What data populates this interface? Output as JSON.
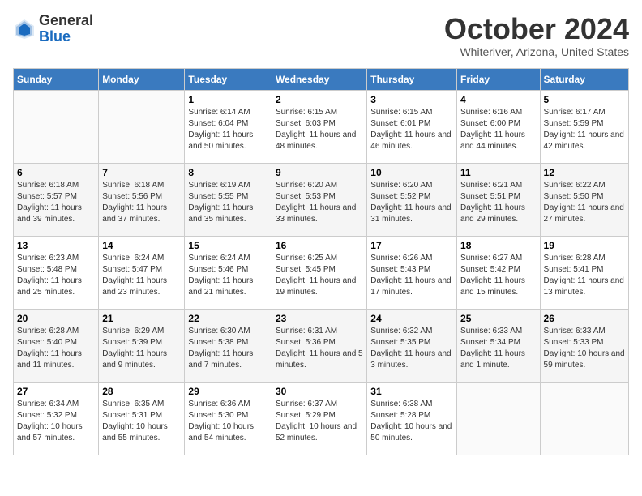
{
  "header": {
    "logo_line1": "General",
    "logo_line2": "Blue",
    "month_title": "October 2024",
    "location": "Whiteriver, Arizona, United States"
  },
  "days_of_week": [
    "Sunday",
    "Monday",
    "Tuesday",
    "Wednesday",
    "Thursday",
    "Friday",
    "Saturday"
  ],
  "weeks": [
    [
      {
        "day": "",
        "info": ""
      },
      {
        "day": "",
        "info": ""
      },
      {
        "day": "1",
        "info": "Sunrise: 6:14 AM\nSunset: 6:04 PM\nDaylight: 11 hours and 50 minutes."
      },
      {
        "day": "2",
        "info": "Sunrise: 6:15 AM\nSunset: 6:03 PM\nDaylight: 11 hours and 48 minutes."
      },
      {
        "day": "3",
        "info": "Sunrise: 6:15 AM\nSunset: 6:01 PM\nDaylight: 11 hours and 46 minutes."
      },
      {
        "day": "4",
        "info": "Sunrise: 6:16 AM\nSunset: 6:00 PM\nDaylight: 11 hours and 44 minutes."
      },
      {
        "day": "5",
        "info": "Sunrise: 6:17 AM\nSunset: 5:59 PM\nDaylight: 11 hours and 42 minutes."
      }
    ],
    [
      {
        "day": "6",
        "info": "Sunrise: 6:18 AM\nSunset: 5:57 PM\nDaylight: 11 hours and 39 minutes."
      },
      {
        "day": "7",
        "info": "Sunrise: 6:18 AM\nSunset: 5:56 PM\nDaylight: 11 hours and 37 minutes."
      },
      {
        "day": "8",
        "info": "Sunrise: 6:19 AM\nSunset: 5:55 PM\nDaylight: 11 hours and 35 minutes."
      },
      {
        "day": "9",
        "info": "Sunrise: 6:20 AM\nSunset: 5:53 PM\nDaylight: 11 hours and 33 minutes."
      },
      {
        "day": "10",
        "info": "Sunrise: 6:20 AM\nSunset: 5:52 PM\nDaylight: 11 hours and 31 minutes."
      },
      {
        "day": "11",
        "info": "Sunrise: 6:21 AM\nSunset: 5:51 PM\nDaylight: 11 hours and 29 minutes."
      },
      {
        "day": "12",
        "info": "Sunrise: 6:22 AM\nSunset: 5:50 PM\nDaylight: 11 hours and 27 minutes."
      }
    ],
    [
      {
        "day": "13",
        "info": "Sunrise: 6:23 AM\nSunset: 5:48 PM\nDaylight: 11 hours and 25 minutes."
      },
      {
        "day": "14",
        "info": "Sunrise: 6:24 AM\nSunset: 5:47 PM\nDaylight: 11 hours and 23 minutes."
      },
      {
        "day": "15",
        "info": "Sunrise: 6:24 AM\nSunset: 5:46 PM\nDaylight: 11 hours and 21 minutes."
      },
      {
        "day": "16",
        "info": "Sunrise: 6:25 AM\nSunset: 5:45 PM\nDaylight: 11 hours and 19 minutes."
      },
      {
        "day": "17",
        "info": "Sunrise: 6:26 AM\nSunset: 5:43 PM\nDaylight: 11 hours and 17 minutes."
      },
      {
        "day": "18",
        "info": "Sunrise: 6:27 AM\nSunset: 5:42 PM\nDaylight: 11 hours and 15 minutes."
      },
      {
        "day": "19",
        "info": "Sunrise: 6:28 AM\nSunset: 5:41 PM\nDaylight: 11 hours and 13 minutes."
      }
    ],
    [
      {
        "day": "20",
        "info": "Sunrise: 6:28 AM\nSunset: 5:40 PM\nDaylight: 11 hours and 11 minutes."
      },
      {
        "day": "21",
        "info": "Sunrise: 6:29 AM\nSunset: 5:39 PM\nDaylight: 11 hours and 9 minutes."
      },
      {
        "day": "22",
        "info": "Sunrise: 6:30 AM\nSunset: 5:38 PM\nDaylight: 11 hours and 7 minutes."
      },
      {
        "day": "23",
        "info": "Sunrise: 6:31 AM\nSunset: 5:36 PM\nDaylight: 11 hours and 5 minutes."
      },
      {
        "day": "24",
        "info": "Sunrise: 6:32 AM\nSunset: 5:35 PM\nDaylight: 11 hours and 3 minutes."
      },
      {
        "day": "25",
        "info": "Sunrise: 6:33 AM\nSunset: 5:34 PM\nDaylight: 11 hours and 1 minute."
      },
      {
        "day": "26",
        "info": "Sunrise: 6:33 AM\nSunset: 5:33 PM\nDaylight: 10 hours and 59 minutes."
      }
    ],
    [
      {
        "day": "27",
        "info": "Sunrise: 6:34 AM\nSunset: 5:32 PM\nDaylight: 10 hours and 57 minutes."
      },
      {
        "day": "28",
        "info": "Sunrise: 6:35 AM\nSunset: 5:31 PM\nDaylight: 10 hours and 55 minutes."
      },
      {
        "day": "29",
        "info": "Sunrise: 6:36 AM\nSunset: 5:30 PM\nDaylight: 10 hours and 54 minutes."
      },
      {
        "day": "30",
        "info": "Sunrise: 6:37 AM\nSunset: 5:29 PM\nDaylight: 10 hours and 52 minutes."
      },
      {
        "day": "31",
        "info": "Sunrise: 6:38 AM\nSunset: 5:28 PM\nDaylight: 10 hours and 50 minutes."
      },
      {
        "day": "",
        "info": ""
      },
      {
        "day": "",
        "info": ""
      }
    ]
  ]
}
